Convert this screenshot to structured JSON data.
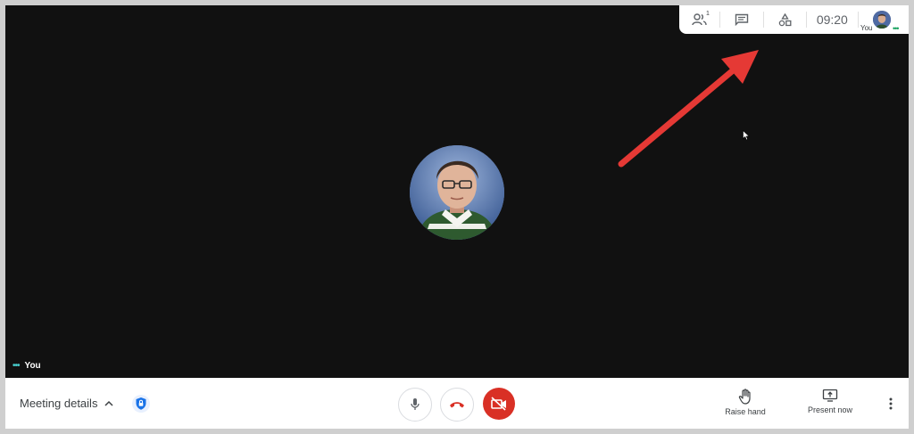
{
  "top_panel": {
    "people_count": "1",
    "clock": "09:20",
    "self_label": "You",
    "icons": [
      "people-icon",
      "chat-icon",
      "activities-icon"
    ]
  },
  "stage": {
    "participant_label": "You"
  },
  "bottom_bar": {
    "meeting_details_label": "Meeting details",
    "raise_hand_label": "Raise hand",
    "present_now_label": "Present now"
  },
  "colors": {
    "stage_bg": "#111111",
    "hangup_red": "#d93025",
    "annotation_arrow": "#e53935",
    "security_blue": "#1a73e8"
  }
}
